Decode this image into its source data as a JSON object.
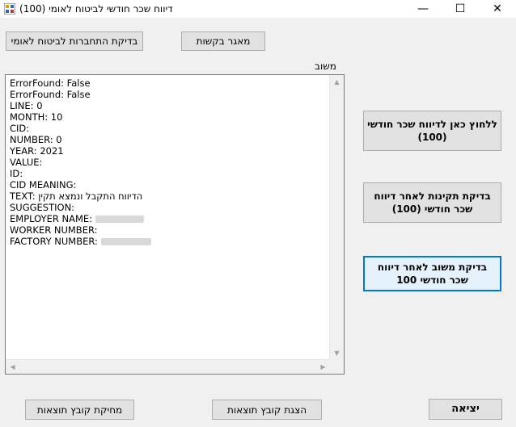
{
  "window": {
    "title": "דיווח שכר חודשי לביטוח לאומי (100)",
    "minimize_glyph": "—",
    "maximize_glyph": "☐",
    "close_glyph": "✕"
  },
  "buttons": {
    "connection_check": "בדיקת התחברות לביטוח לאומי",
    "request_repository": "מאגר בקשות",
    "report_monthly_salary": "ללחוץ כאן לדיווח שכר חודשי (100)",
    "validity_check": "בדיקת תקינות לאחר דיווח שכר חודשי (100)",
    "feedback_check": "בדיקת משוב לאחר דיווח שכר חודשי 100",
    "delete_results_file": "מחיקת קובץ תוצאות",
    "show_results_file": "הצגת קובץ תוצאות",
    "exit": "יציאה"
  },
  "feedback_label": "משוב",
  "feedback_lines": [
    "ErrorFound: False",
    "ErrorFound: False",
    "LINE: 0",
    "MONTH: 10",
    "CID:",
    "NUMBER: 0",
    "YEAR: 2021",
    "VALUE:",
    "ID:",
    "CID MEANING:",
    "TEXT: הדיווח התקבל ונמצא תקין",
    "SUGGESTION:",
    "EMPLOYER NAME:",
    "WORKER NUMBER:",
    "FACTORY NUMBER:"
  ],
  "icons": {
    "app": "app-icon",
    "scroll_up": "▲",
    "scroll_down": "▼",
    "scroll_left": "◀",
    "scroll_right": "▶"
  },
  "colors": {
    "accent": "#0078d7",
    "background": "#f0f0f0"
  }
}
